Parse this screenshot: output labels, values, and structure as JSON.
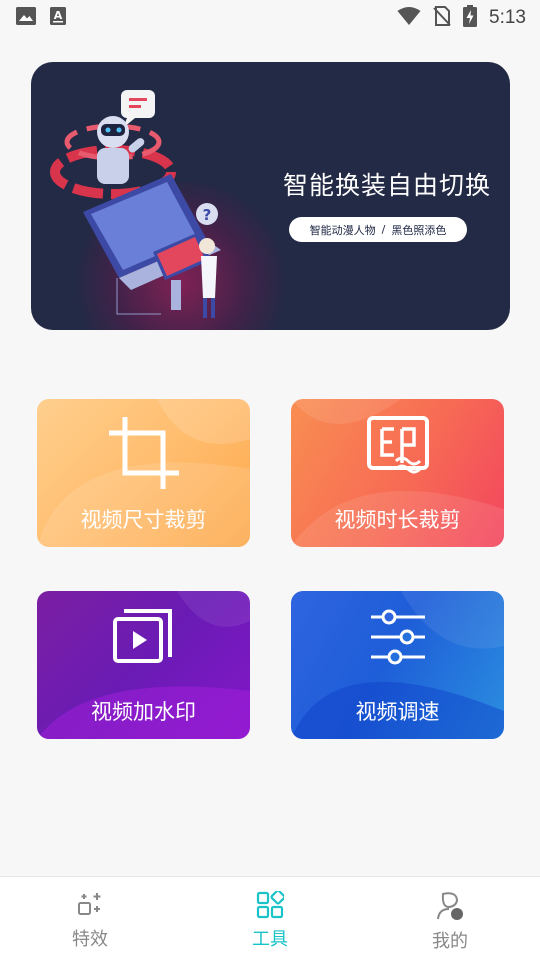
{
  "status_bar": {
    "time": "5:13",
    "icons": [
      "image-icon",
      "a-keyboard-icon",
      "wifi-icon",
      "no-sim-icon",
      "battery-charging-icon"
    ]
  },
  "banner": {
    "title": "智能换装自由切换",
    "pill_left": "智能动漫人物",
    "pill_sep": "/",
    "pill_right": "黑色照添色"
  },
  "tools": [
    {
      "label": "视频尺寸裁剪",
      "icon": "crop-icon"
    },
    {
      "label": "视频时长裁剪",
      "icon": "stamp-icon"
    },
    {
      "label": "视频加水印",
      "icon": "video-watermark-icon"
    },
    {
      "label": "视频调速",
      "icon": "sliders-icon"
    }
  ],
  "bottom_nav": {
    "items": [
      {
        "label": "特效",
        "icon": "sparkle-icon",
        "active": false
      },
      {
        "label": "工具",
        "icon": "grid-icon",
        "active": true
      },
      {
        "label": "我的",
        "icon": "profile-icon",
        "active": false
      }
    ],
    "active_color": "#19c3c8",
    "inactive_color": "#888888"
  }
}
